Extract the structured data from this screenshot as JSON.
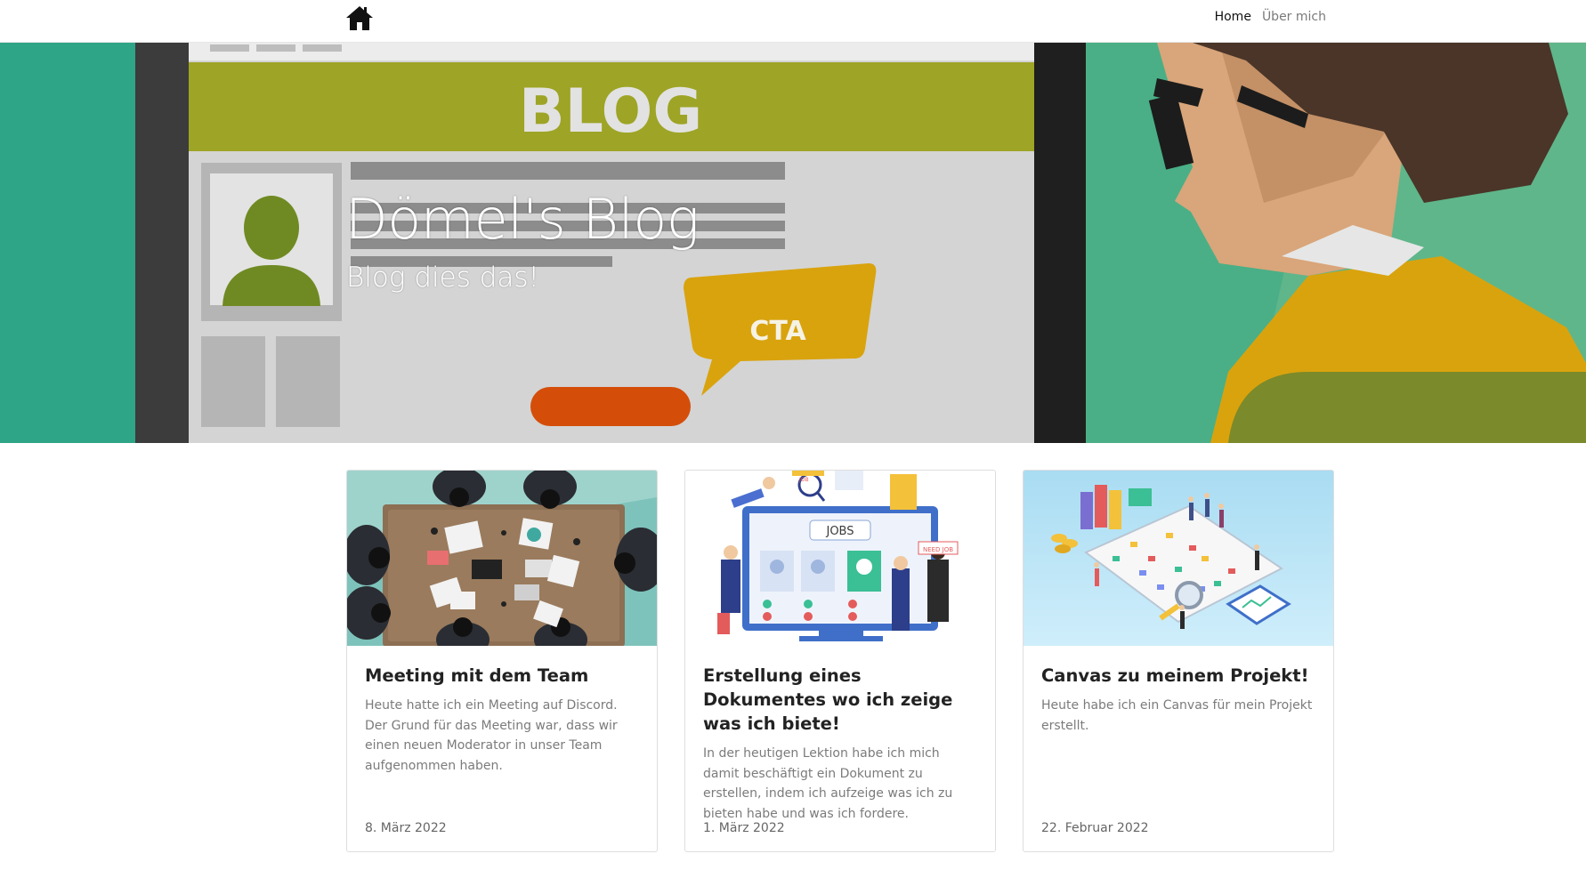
{
  "nav": {
    "home_icon": "home-icon",
    "links": [
      {
        "label": "Home",
        "active": true
      },
      {
        "label": "Über mich",
        "active": false
      }
    ]
  },
  "hero": {
    "title": "Dömel's Blog",
    "subtitle": "Blog dies das!",
    "art_text": {
      "blog": "BLOG",
      "cta": "CTA"
    }
  },
  "cards": [
    {
      "title": "Meeting mit dem Team",
      "text": "Heute hatte ich ein Meeting auf Discord. Der Grund für das Meeting war, dass wir einen neuen Moderator in unser Team aufgenommen haben.",
      "date": "8. März 2022",
      "image": "team-meeting-illustration"
    },
    {
      "title": "Erstellung eines Dokumentes wo ich zeige was ich biete!",
      "text": "In der heutigen Lektion habe ich mich damit beschäftigt ein Dokument zu erstellen, indem ich aufzeige was ich zu bieten habe und was ich fordere.",
      "date": "1. März 2022",
      "image": "jobs-board-illustration",
      "art_text": {
        "jobs": "JOBS",
        "need_job": "NEED JOB",
        "job": "JOB"
      }
    },
    {
      "title": "Canvas zu meinem Projekt!",
      "text": "Heute habe ich ein Canvas für mein Projekt erstellt.",
      "date": "22. Februar 2022",
      "image": "project-canvas-illustration"
    }
  ],
  "colors": {
    "hero_teal": "#2ea587",
    "hero_green_right": "#63b98a",
    "blog_banner": "#9ea425",
    "cta_bubble": "#d9a30e",
    "orange_button": "#d44e0a"
  }
}
